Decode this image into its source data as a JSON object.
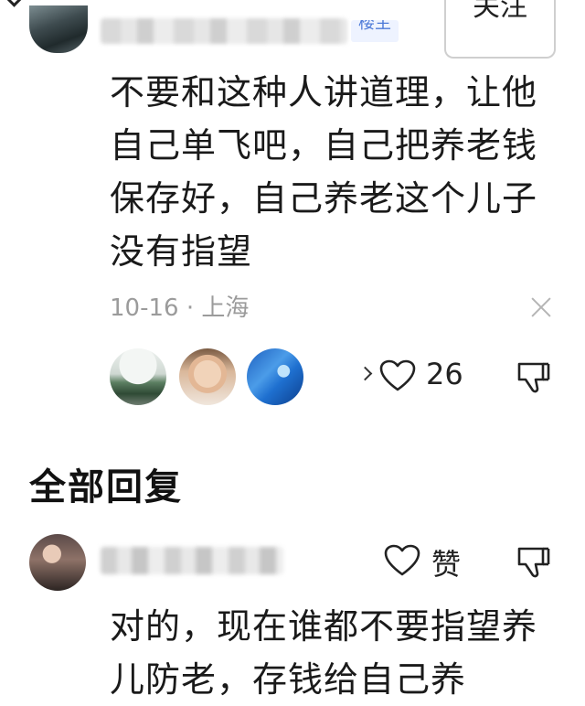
{
  "op_comment": {
    "badge": "楼主",
    "follow_label": "关注",
    "text": "不要和这种人讲道理，让他自己单飞吧，自己把养老钱保存好，自己养老这个儿子没有指望",
    "meta": "10-16 · 上海",
    "like_count": "26"
  },
  "section": {
    "title": "全部回复"
  },
  "reply": {
    "like_label": "赞",
    "text": "对的，现在谁都不要指望养儿防老，存钱给自己养"
  },
  "icons": {
    "heart": "heart-icon",
    "dislike": "thumbs-down-icon",
    "close": "close-icon",
    "chevron": "chevron-right-icon"
  }
}
